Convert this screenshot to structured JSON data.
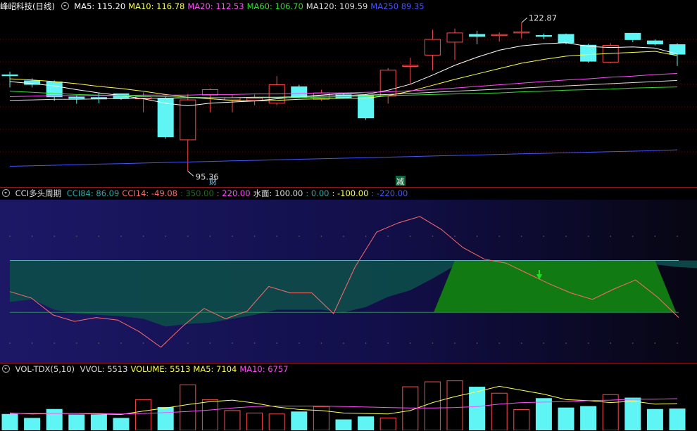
{
  "main": {
    "title": "峰岹科技(日线)",
    "ma": [
      {
        "label": "MA5: ",
        "value": "115.20",
        "color": "#ffffff"
      },
      {
        "label": "MA10: ",
        "value": "116.78",
        "color": "#ffff4d"
      },
      {
        "label": "MA20: ",
        "value": "112.53",
        "color": "#ff4dff"
      },
      {
        "label": "MA60: ",
        "value": "106.70",
        "color": "#33dd33"
      },
      {
        "label": "MA120: ",
        "value": "109.59",
        "color": "#dddddd"
      },
      {
        "label": "MA250 ",
        "value": "89.35",
        "color": "#4455ff"
      }
    ],
    "high_label": "122.87",
    "low_label": "95.36",
    "marker_cai": "财",
    "marker_jian": "减"
  },
  "cci": {
    "title": "CCI多头周期",
    "items": [
      {
        "label": "CCI84: ",
        "value": "86.09",
        "color": "#2aa8a8"
      },
      {
        "label": "CCI14: ",
        "value": "-49.08",
        "color": "#ff6b6b"
      },
      {
        "label": ": ",
        "value": "350.00",
        "color": "#1d6a1d"
      },
      {
        "label": ": ",
        "value": "220.00",
        "color": "#ff4dff"
      },
      {
        "label": "水面: ",
        "value": "100.00",
        "color": "#dddddd"
      },
      {
        "label": ": ",
        "value": "0.00",
        "color": "#2aa8a8"
      },
      {
        "label": ": ",
        "value": "-100.00",
        "color": "#ffff4d"
      },
      {
        "label": ": ",
        "value": "-220.00",
        "color": "#4455ff"
      }
    ]
  },
  "vol": {
    "title": "VOL-TDX(5,10)",
    "items": [
      {
        "label": "VVOL: ",
        "value": "5513",
        "color": "#dddddd"
      },
      {
        "label": "VOLUME: ",
        "value": "5513",
        "color": "#ffff4d"
      },
      {
        "label": "MA5: ",
        "value": "7104",
        "color": "#ffff4d"
      },
      {
        "label": "MA10: ",
        "value": "6757",
        "color": "#ff4dff"
      }
    ]
  },
  "chart_data": [
    {
      "type": "candlestick",
      "colors": {
        "up": "#ff4a4a",
        "down": "#5ff5f5"
      },
      "candles": [
        {
          "o": 113.3,
          "h": 113.8,
          "l": 110.9,
          "c": 113.0
        },
        {
          "o": 112.2,
          "h": 112.6,
          "l": 110.9,
          "c": 111.4
        },
        {
          "o": 112.0,
          "h": 112.2,
          "l": 108.4,
          "c": 109.1
        },
        {
          "o": 109.2,
          "h": 109.5,
          "l": 107.9,
          "c": 108.8
        },
        {
          "o": 109.1,
          "h": 109.9,
          "l": 108.0,
          "c": 108.7
        },
        {
          "o": 109.8,
          "h": 109.8,
          "l": 108.6,
          "c": 108.9
        },
        {
          "o": 108.8,
          "h": 110.0,
          "l": 106.3,
          "c": 109.2
        },
        {
          "o": 109.0,
          "h": 109.3,
          "l": 101.4,
          "c": 101.7
        },
        {
          "o": 101.2,
          "h": 109.7,
          "l": 95.4,
          "c": 108.6
        },
        {
          "o": 109.5,
          "h": 110.7,
          "l": 106.3,
          "c": 110.5
        },
        {
          "o": 108.6,
          "h": 109.6,
          "l": 106.3,
          "c": 109.0
        },
        {
          "o": 108.5,
          "h": 109.6,
          "l": 107.6,
          "c": 108.9
        },
        {
          "o": 108.0,
          "h": 113.0,
          "l": 107.6,
          "c": 111.4
        },
        {
          "o": 111.1,
          "h": 111.4,
          "l": 108.9,
          "c": 109.0
        },
        {
          "o": 108.7,
          "h": 110.5,
          "l": 108.4,
          "c": 109.9
        },
        {
          "o": 109.6,
          "h": 109.8,
          "l": 108.8,
          "c": 108.9
        },
        {
          "o": 109.5,
          "h": 109.7,
          "l": 104.9,
          "c": 105.2
        },
        {
          "o": 109.3,
          "h": 114.5,
          "l": 107.9,
          "c": 114.1
        },
        {
          "o": 114.8,
          "h": 116.4,
          "l": 111.6,
          "c": 115.0
        },
        {
          "o": 116.9,
          "h": 121.6,
          "l": 114.1,
          "c": 119.8
        },
        {
          "o": 119.3,
          "h": 121.8,
          "l": 116.0,
          "c": 121.0
        },
        {
          "o": 120.8,
          "h": 121.4,
          "l": 118.9,
          "c": 120.3
        },
        {
          "o": 120.7,
          "h": 121.1,
          "l": 119.4,
          "c": 120.7
        },
        {
          "o": 121.1,
          "h": 122.9,
          "l": 120.0,
          "c": 121.2
        },
        {
          "o": 120.6,
          "h": 120.9,
          "l": 119.9,
          "c": 120.3
        },
        {
          "o": 120.8,
          "h": 120.9,
          "l": 118.9,
          "c": 119.1
        },
        {
          "o": 118.8,
          "h": 119.0,
          "l": 115.5,
          "c": 115.7
        },
        {
          "o": 115.6,
          "h": 119.1,
          "l": 115.4,
          "c": 118.7
        },
        {
          "o": 121.0,
          "h": 121.0,
          "l": 119.3,
          "c": 119.7
        },
        {
          "o": 119.6,
          "h": 119.8,
          "l": 118.7,
          "c": 118.9
        },
        {
          "o": 118.9,
          "h": 119.1,
          "l": 114.9,
          "c": 117.0
        }
      ],
      "ma_lines": [
        {
          "name": "MA5",
          "color": "#ffffff",
          "values": [
            112.0,
            111.6,
            111.2,
            110.5,
            109.9,
            109.4,
            108.8,
            108.0,
            107.5,
            108.0,
            108.2,
            108.4,
            108.8,
            109.2,
            109.5,
            109.8,
            109.6,
            110.4,
            111.5,
            113.2,
            115.0,
            116.5,
            117.8,
            118.6,
            119.0,
            119.2,
            118.5,
            118.3,
            118.4,
            118.2,
            117.1
          ]
        },
        {
          "name": "MA10",
          "color": "#ffff4d",
          "values": [
            112.5,
            112.3,
            112.0,
            111.6,
            111.1,
            110.7,
            110.2,
            109.6,
            109.1,
            108.8,
            108.5,
            108.4,
            108.5,
            108.7,
            108.8,
            108.9,
            108.9,
            109.4,
            110.2,
            111.3,
            112.4,
            113.4,
            114.4,
            115.4,
            116.1,
            116.7,
            117.0,
            117.2,
            117.4,
            117.6,
            116.8
          ]
        },
        {
          "name": "MA20",
          "color": "#ff4dff",
          "values": [
            109.2,
            109.3,
            109.4,
            109.4,
            109.4,
            109.4,
            109.5,
            109.5,
            109.5,
            109.6,
            109.6,
            109.7,
            109.7,
            109.8,
            109.9,
            109.9,
            110.0,
            110.1,
            110.3,
            110.5,
            110.8,
            111.1,
            111.4,
            111.7,
            112.0,
            112.3,
            112.5,
            112.8,
            113.0,
            113.3,
            113.5
          ]
        },
        {
          "name": "MA60",
          "color": "#33dd33",
          "values": [
            110.2,
            110.0,
            109.8,
            109.6,
            109.5,
            109.4,
            109.3,
            109.2,
            109.1,
            109.0,
            109.0,
            109.0,
            109.0,
            109.0,
            109.1,
            109.2,
            109.3,
            109.4,
            109.5,
            109.6,
            109.7,
            109.8,
            109.9,
            110.1,
            110.2,
            110.4,
            110.5,
            110.6,
            110.8,
            110.9,
            111.0
          ]
        },
        {
          "name": "MA120",
          "color": "#dddddd",
          "values": [
            108.5,
            108.6,
            108.7,
            108.7,
            108.8,
            108.8,
            108.9,
            108.9,
            109.0,
            109.0,
            109.0,
            109.1,
            109.1,
            109.2,
            109.3,
            109.4,
            109.5,
            109.6,
            109.8,
            110.0,
            110.2,
            110.4,
            110.6,
            110.8,
            111.0,
            111.2,
            111.4,
            111.6,
            111.8,
            112.0,
            112.2
          ]
        },
        {
          "name": "MA250",
          "color": "#4455ff",
          "values": [
            96.3,
            96.4,
            96.5,
            96.6,
            96.7,
            96.8,
            96.9,
            97.0,
            97.1,
            97.2,
            97.3,
            97.4,
            97.5,
            97.6,
            97.7,
            97.8,
            97.9,
            98.0,
            98.1,
            98.2,
            98.3,
            98.4,
            98.5,
            98.6,
            98.7,
            98.8,
            98.9,
            99.0,
            99.1,
            99.2,
            99.35
          ]
        }
      ],
      "ylim": [
        93.5,
        124.5
      ]
    },
    {
      "type": "line",
      "name": "CCI",
      "cci14": [
        -20,
        -45,
        -110,
        -135,
        -120,
        -130,
        -175,
        -235,
        -155,
        -85,
        -125,
        -95,
        0,
        -25,
        -25,
        -105,
        75,
        210,
        245,
        270,
        220,
        150,
        105,
        90,
        50,
        10,
        -25,
        -50,
        -10,
        25,
        -40,
        -120
      ],
      "cci84": [
        -60,
        -50,
        -90,
        -105,
        -110,
        -115,
        -125,
        -155,
        -145,
        -140,
        -125,
        -110,
        -90,
        -90,
        -90,
        -100,
        -80,
        -40,
        -15,
        30,
        80,
        100,
        100,
        95,
        85,
        70,
        60,
        55,
        70,
        85,
        75,
        70
      ],
      "levels": {
        "water": 100,
        "zero": 0,
        "neg100": -100
      },
      "ylim": [
        -295,
        335
      ]
    },
    {
      "type": "bar",
      "name": "VOL",
      "volumes": [
        3300,
        2500,
        4300,
        3200,
        3200,
        2500,
        6200,
        4700,
        9200,
        6200,
        4000,
        3500,
        3300,
        3800,
        4800,
        2200,
        2800,
        2500,
        8800,
        9800,
        10000,
        8800,
        7500,
        4200,
        6500,
        4600,
        4900,
        7200,
        6600,
        4300,
        4400
      ],
      "ma5": [
        3500,
        3300,
        3400,
        3400,
        3300,
        3200,
        3900,
        4500,
        5200,
        5800,
        6100,
        5500,
        4700,
        4200,
        4000,
        3500,
        3400,
        3300,
        4000,
        5600,
        6800,
        7800,
        8900,
        8100,
        7300,
        6200,
        6000,
        5600,
        5900,
        5300,
        5400
      ],
      "ma10": [
        3400,
        3400,
        3400,
        3400,
        3400,
        3300,
        3400,
        3600,
        3800,
        4100,
        4500,
        4800,
        4900,
        4900,
        4900,
        4800,
        4700,
        4600,
        4500,
        4500,
        4600,
        4800,
        5300,
        5600,
        5700,
        5800,
        6000,
        6100,
        6300,
        6300,
        6400
      ],
      "ylim": [
        0,
        10800
      ]
    }
  ]
}
